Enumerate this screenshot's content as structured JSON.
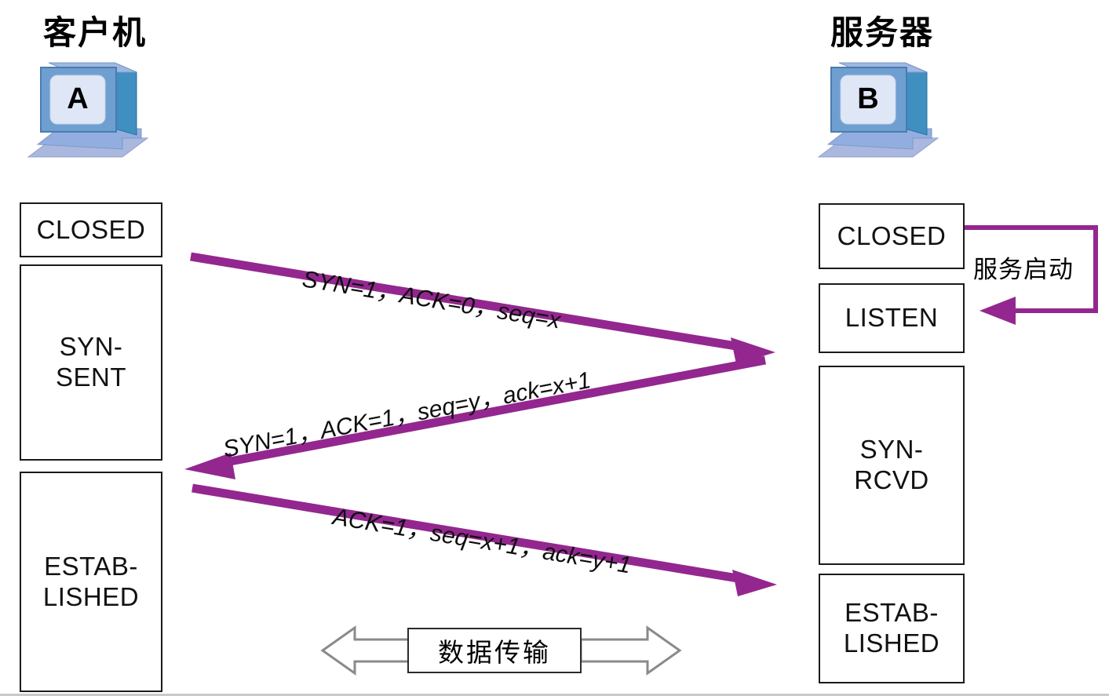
{
  "diagram": {
    "title_client": "客户机",
    "title_server": "服务器",
    "client_icon_letter": "A",
    "server_icon_letter": "B",
    "arrow_color": "#93278f",
    "box_border_color": "#1a1a1a",
    "data_arrow_color": "#808080"
  },
  "client_states": [
    {
      "label": "CLOSED"
    },
    {
      "label": "SYN-\nSENT"
    },
    {
      "label": "ESTAB-\nLISHED"
    }
  ],
  "server_states": [
    {
      "label": "CLOSED"
    },
    {
      "label": "LISTEN"
    },
    {
      "label": "SYN-\nRCVD"
    },
    {
      "label": "ESTAB-\nLISHED"
    }
  ],
  "messages": [
    {
      "text": "SYN=1，ACK=0，seq=x",
      "direction": "client-to-server"
    },
    {
      "text": "SYN=1，ACK=1，seq=y，ack=x+1",
      "direction": "server-to-client"
    },
    {
      "text": "ACK=1，seq=x+1，ack=y+1",
      "direction": "client-to-server"
    }
  ],
  "annotations": {
    "service_start": "服务启动",
    "data_transfer": "数据传输"
  }
}
